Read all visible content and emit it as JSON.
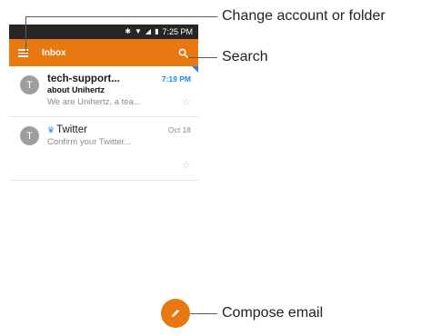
{
  "status_bar": {
    "time": "7:25 PM"
  },
  "app_bar": {
    "title": "Inbox",
    "menu_icon": "hamburger-menu-icon",
    "search_icon": "search-icon"
  },
  "emails": [
    {
      "avatar_letter": "T",
      "sender": "tech-support...",
      "time": "7:19 PM",
      "subject": "about Unihertz",
      "preview": "We are Unihertz, a tea...",
      "unread": true
    },
    {
      "avatar_letter": "T",
      "sender": "Twitter",
      "time": "Oct 18",
      "preview": "Confirm your Twitter...",
      "unread": false
    }
  ],
  "callouts": {
    "menu": "Change account or folder",
    "search": "Search",
    "compose": "Compose email"
  },
  "colors": {
    "accent": "#e87810",
    "unread_time": "#1e88e5"
  }
}
